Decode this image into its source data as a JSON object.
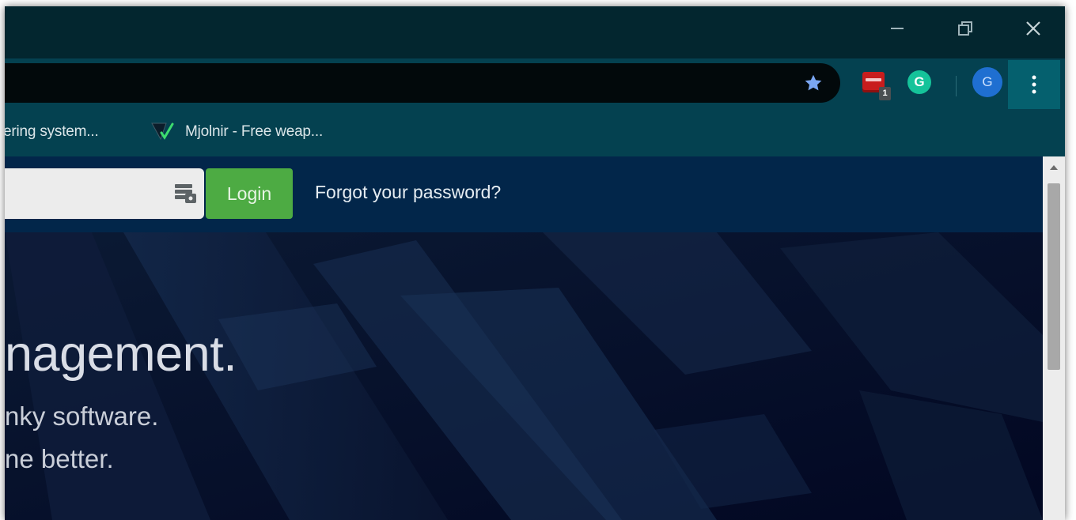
{
  "window_controls": {
    "minimize_icon": "minimize-icon",
    "maximize_icon": "restore-icon",
    "close_icon": "close-icon"
  },
  "toolbar": {
    "bookmark_icon": "star-icon",
    "extensions": [
      {
        "icon": "red-extension-icon",
        "badge": "1"
      },
      {
        "icon": "grammarly-icon",
        "letter": "G"
      }
    ],
    "profile": {
      "initial": "G",
      "color": "#1f6fd1"
    },
    "menu_icon": "kebab-menu-icon"
  },
  "bookmarks": [
    {
      "label": "ering system..."
    },
    {
      "label": "Mjolnir - Free weap...",
      "icon": "checkmark-icon"
    }
  ],
  "login_bar": {
    "password_value": "",
    "login_label": "Login",
    "forgot_label": "Forgot your password?",
    "login_color": "#4dab43"
  },
  "hero": {
    "title": "nagement.",
    "line1": "nky software.",
    "line2": "ne better."
  }
}
